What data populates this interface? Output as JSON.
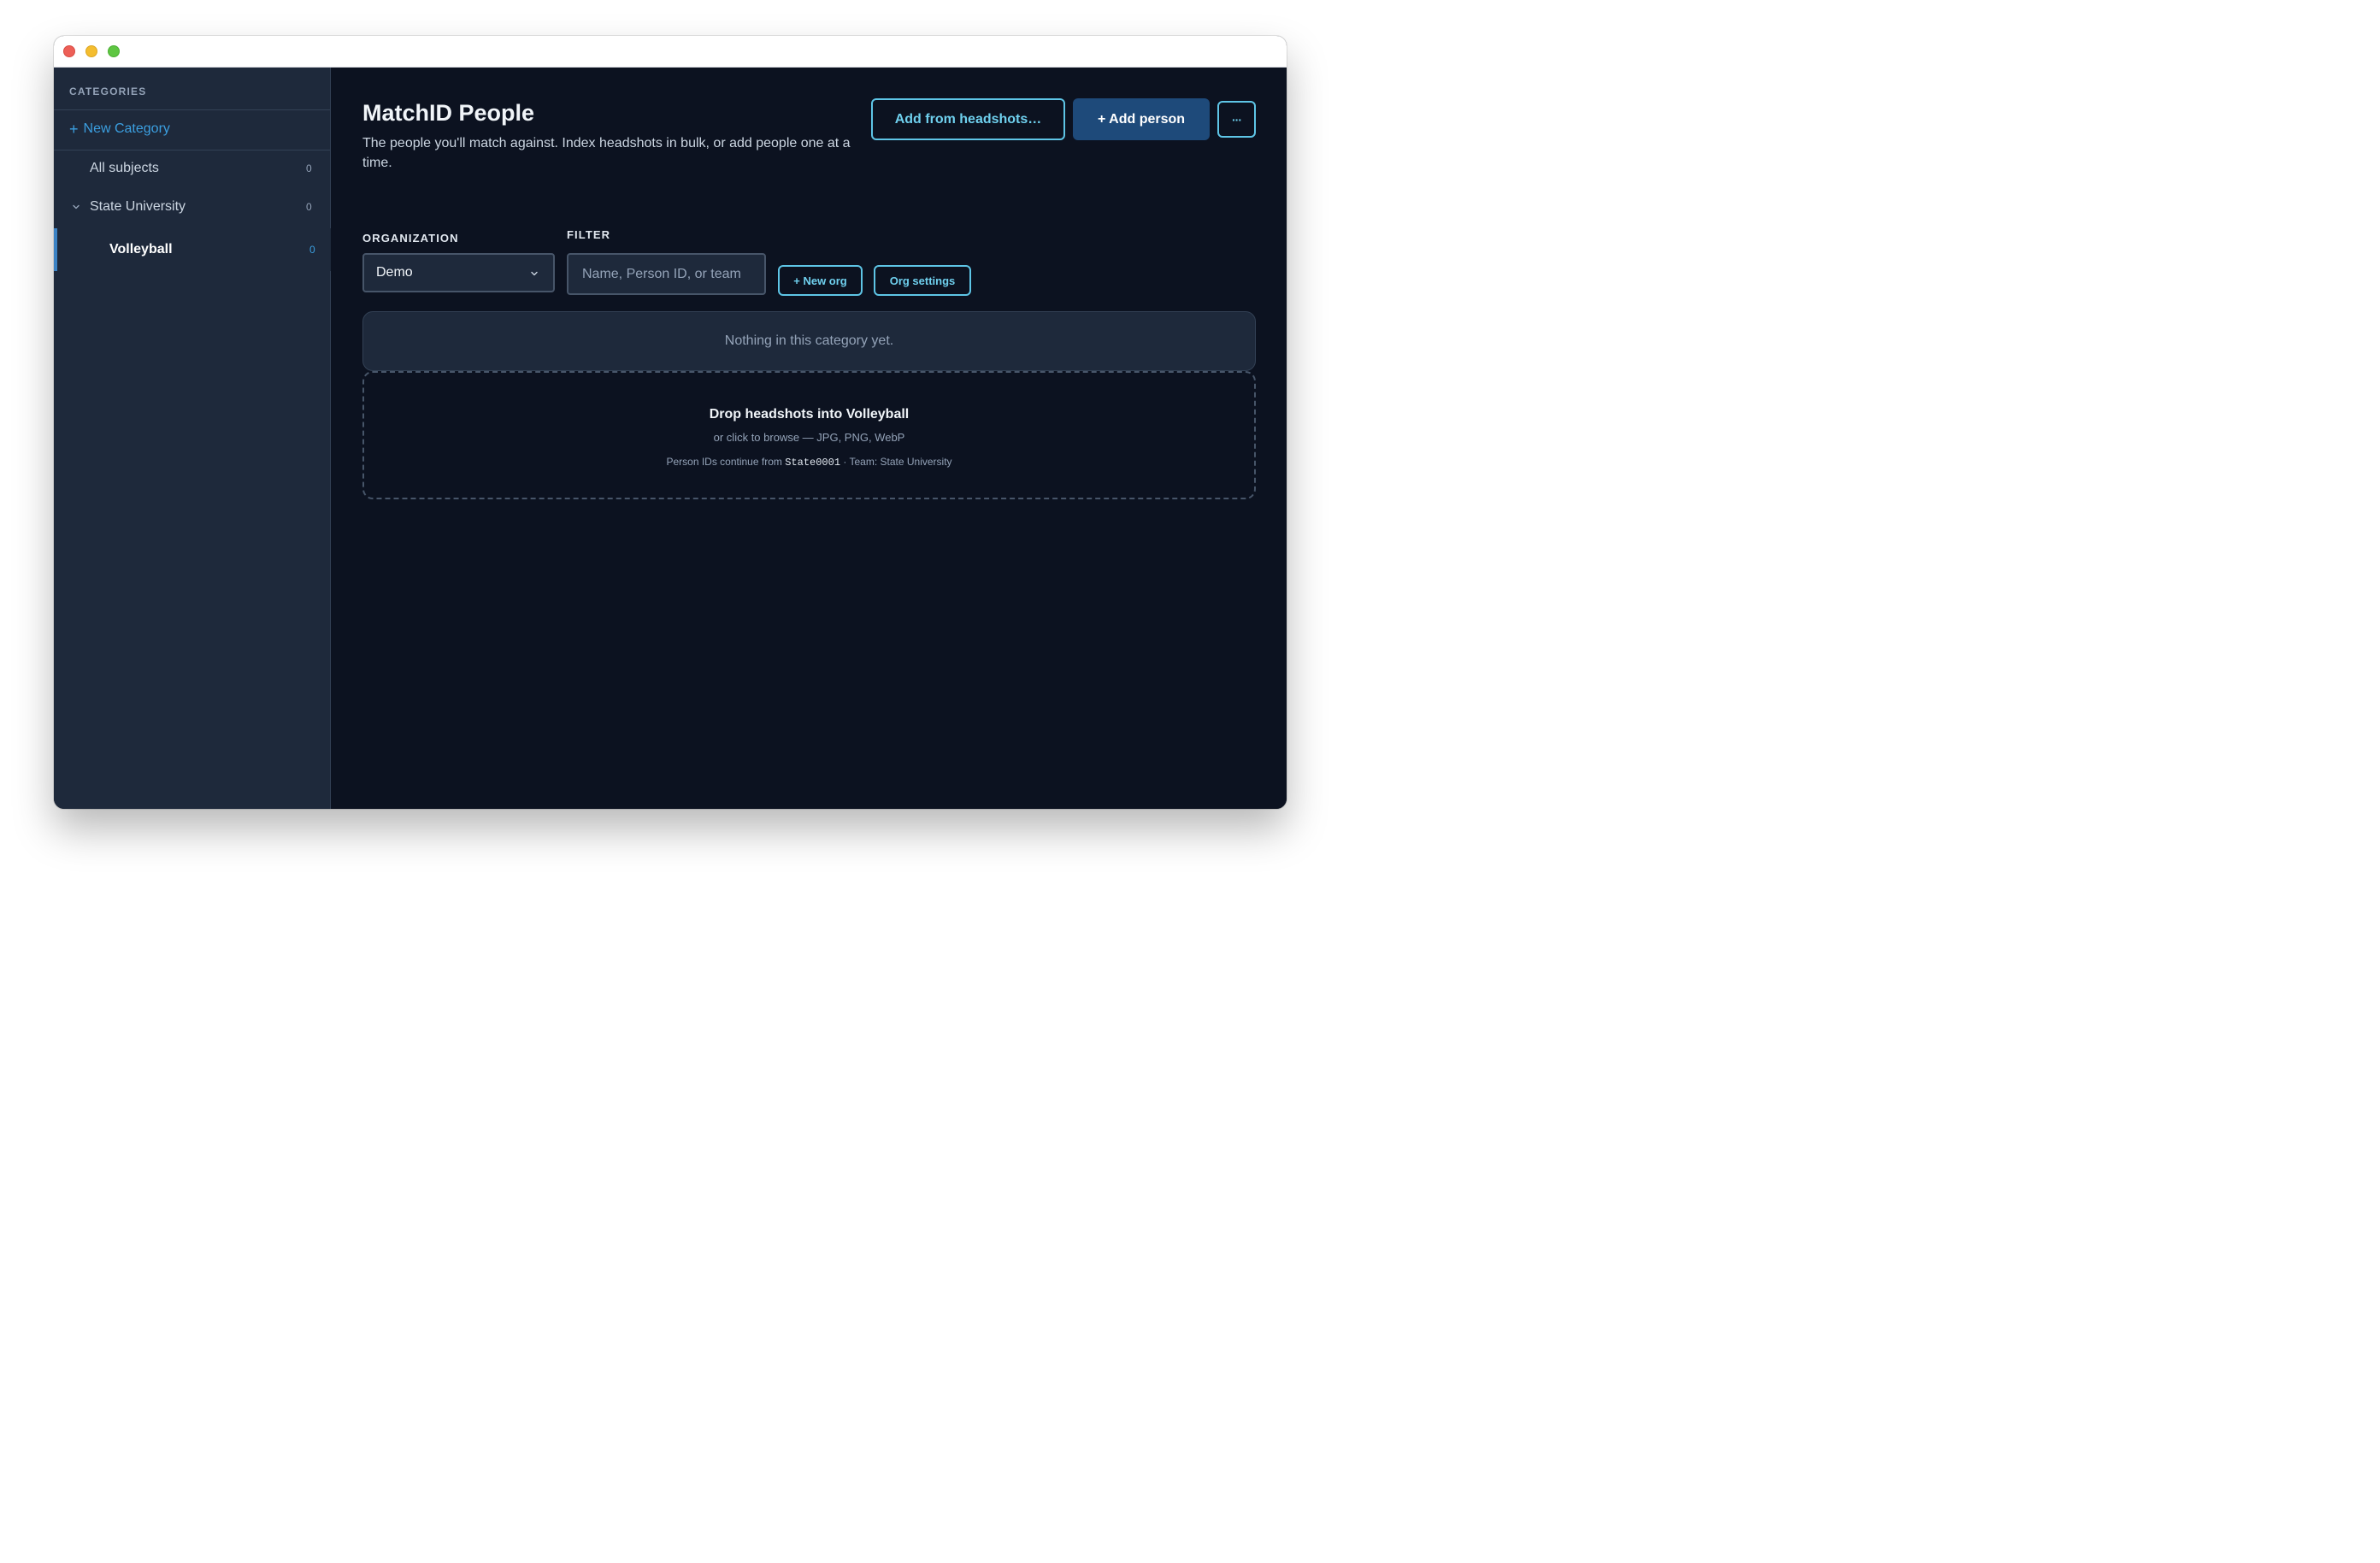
{
  "sidebar": {
    "heading": "CATEGORIES",
    "new_category_label": "New Category",
    "items": [
      {
        "label": "All subjects",
        "count": "0"
      },
      {
        "label": "State University",
        "count": "0"
      },
      {
        "label": "Volleyball",
        "count": "0"
      }
    ]
  },
  "main": {
    "title": "MatchID People",
    "subtitle": "The people you'll match against. Index headshots in bulk, or add people one at a time.",
    "add_from_headshots_label": "Add from headshots…",
    "add_person_label": "+ Add person",
    "more_label": "···",
    "organization_label": "ORGANIZATION",
    "organization_value": "Demo",
    "filter_label": "FILTER",
    "filter_placeholder": "Name, Person ID, or team",
    "new_org_label": "+ New org",
    "org_settings_label": "Org settings",
    "empty_message": "Nothing in this category yet.",
    "dropzone": {
      "title": "Drop headshots into Volleyball",
      "subtitle": "or click to browse — JPG, PNG, WebP",
      "meta_prefix": "Person IDs continue from",
      "meta_id": "State0001",
      "meta_suffix": "· Team: State University"
    }
  },
  "colors": {
    "accent": "#5ec5e6",
    "primary_button": "#1e4a7a",
    "background": "#0c1220",
    "sidebar": "#1e293b",
    "link": "#3b9fe0"
  }
}
